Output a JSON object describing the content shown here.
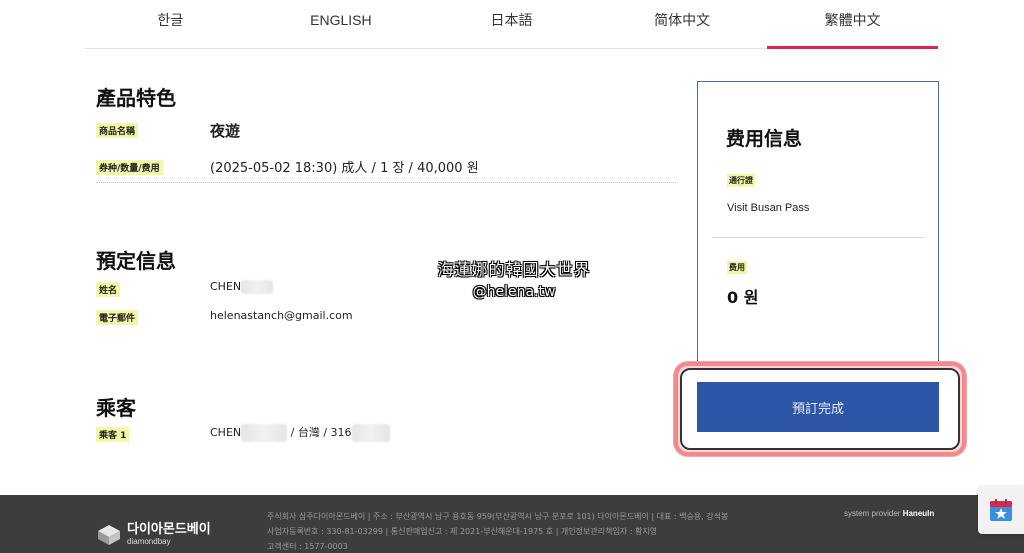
{
  "tabs": [
    {
      "label": "한글",
      "active": false
    },
    {
      "label": "ENGLISH",
      "active": false
    },
    {
      "label": "日本語",
      "active": false
    },
    {
      "label": "简体中文",
      "active": false
    },
    {
      "label": "繁體中文",
      "active": true
    }
  ],
  "product": {
    "title": "產品特色",
    "name_label": "商品名稱",
    "name_value": "夜遊",
    "ticket_label": "券种/数量/费用",
    "ticket_value": "(2025-05-02 18:30) 成人 / 1 장 / 40,000 원"
  },
  "booking": {
    "title": "預定信息",
    "name_label": "姓名",
    "name_value": "CHEN",
    "email_label": "電子郵件",
    "email_value": "helenastanch@gmail.com"
  },
  "passenger": {
    "title": "乘客",
    "label": "乘客 1",
    "name_value": "CHEN",
    "mid_value": "/ 台灣 / 316"
  },
  "fee_panel": {
    "title": "费用信息",
    "pass_label": "通行證",
    "pass_value": "Visit Busan Pass",
    "fee_label": "费用",
    "fee_value": "0 원"
  },
  "book_button": "預訂完成",
  "watermark": {
    "line1": "海蓮娜的韓國大世界",
    "line2": "@helena.tw"
  },
  "footer": {
    "logo_ko": "다이아몬드베이",
    "logo_en": "diamondbay",
    "line1": "주식회사 삼주다이아몬드베이  |  주소 : 부산광역시 남구 용호동 959(부산광역시 남구 분포로 101) 다이아몬드베이  |  대표 : 백승용, 강석봉",
    "line2": "사업자등록번호 : 330-81-03299  |  통신판매업신고 : 제 2021-부산해운대-1975 호  |  개인정보관리책임자 : 황지영",
    "line3": "고객센터 : 1577-0003",
    "provider_prefix": "system provider",
    "provider_name": "Haneuln"
  },
  "colors": {
    "accent_red": "#e0244a",
    "button_blue": "#2e56a6",
    "highlight_yellow": "#f3f7a8",
    "footer_bg": "#3d3d3d"
  }
}
